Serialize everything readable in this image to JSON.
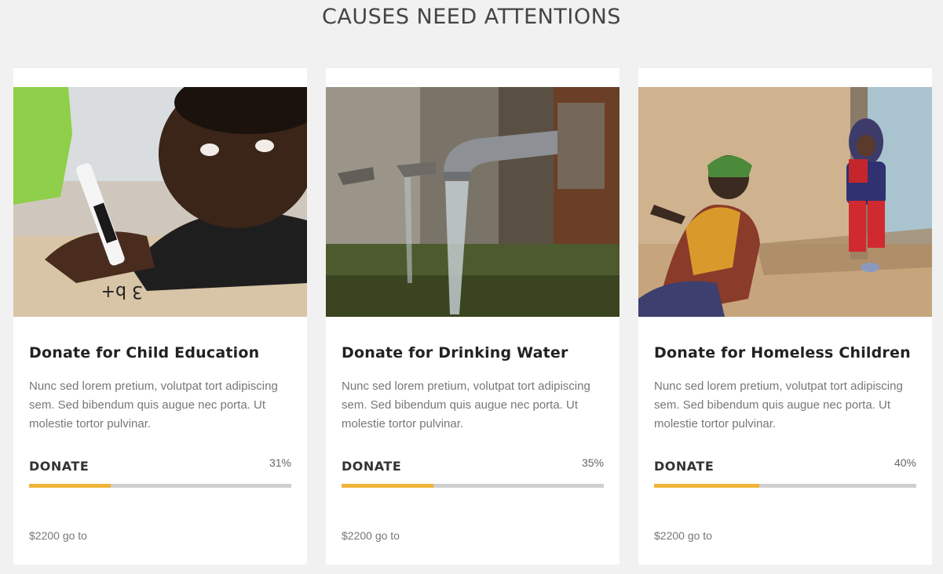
{
  "section": {
    "title": "CAUSES NEED ATTENTIONS"
  },
  "colors": {
    "accent": "#f0b43a",
    "track": "#cfcfcf",
    "background": "#f1f1f1"
  },
  "causes": [
    {
      "title": "Donate for Child Education",
      "text": "Nunc sed lorem pretium, volutpat tort adipiscing sem. Sed bibendum quis augue nec porta. Ut molestie tortor pulvinar.",
      "donate_label": "DONATE",
      "percent_label": "31%",
      "progress": 0.31,
      "goal": "$2200 go to"
    },
    {
      "title": "Donate for Drinking Water",
      "text": "Nunc sed lorem pretium, volutpat tort adipiscing sem. Sed bibendum quis augue nec porta. Ut molestie tortor pulvinar.",
      "donate_label": "DONATE",
      "percent_label": "35%",
      "progress": 0.35,
      "goal": "$2200 go to"
    },
    {
      "title": "Donate for Homeless Children",
      "text": "Nunc sed lorem pretium, volutpat tort adipiscing sem. Sed bibendum quis augue nec porta. Ut molestie tortor pulvinar.",
      "donate_label": "DONATE",
      "percent_label": "40%",
      "progress": 0.4,
      "goal": "$2200 go to"
    }
  ]
}
